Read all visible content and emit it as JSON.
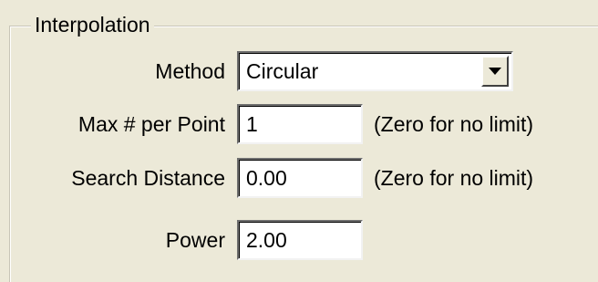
{
  "groupbox": {
    "title": "Interpolation"
  },
  "method": {
    "label": "Method",
    "selected": "Circular"
  },
  "max_per_point": {
    "label": "Max # per Point",
    "value": "1",
    "hint": "(Zero for no limit)"
  },
  "search_distance": {
    "label": "Search Distance",
    "value": "0.00",
    "hint": "(Zero for no limit)"
  },
  "power": {
    "label": "Power",
    "value": "2.00"
  },
  "icons": {
    "dropdown": "chevron-down-icon"
  }
}
